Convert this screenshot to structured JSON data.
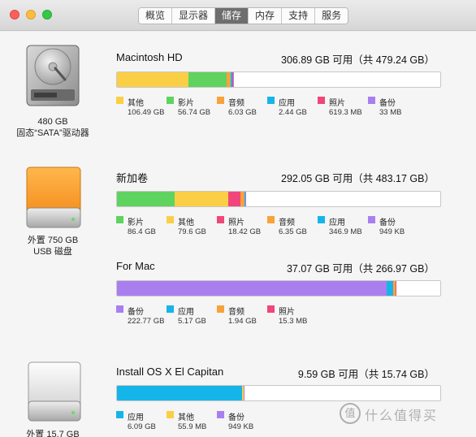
{
  "window": {
    "tabs": [
      {
        "label": "概览",
        "active": false
      },
      {
        "label": "显示器",
        "active": false
      },
      {
        "label": "储存",
        "active": true
      },
      {
        "label": "内存",
        "active": false
      },
      {
        "label": "支持",
        "active": false
      },
      {
        "label": "服务",
        "active": false
      }
    ]
  },
  "colors": {
    "other": "#fbcf45",
    "movies": "#5fd35f",
    "audio": "#f9a23b",
    "apps": "#16b5e9",
    "photos": "#f0467a",
    "backups": "#a97ff0"
  },
  "drives": [
    {
      "icon": "internal-hard-disk-icon",
      "caption_line1": "480 GB",
      "caption_line2": "固态“SATA”驱动器",
      "volumes": [
        {
          "name": "Macintosh HD",
          "summary": "306.89 GB 可用（共 479.24 GB）",
          "segments": [
            {
              "category": "other",
              "fraction": 0.222
            },
            {
              "category": "movies",
              "fraction": 0.118
            },
            {
              "category": "audio",
              "fraction": 0.013
            },
            {
              "category": "apps",
              "fraction": 0.005
            },
            {
              "category": "photos",
              "fraction": 0.002
            },
            {
              "category": "backups",
              "fraction": 0.001
            }
          ],
          "legend": [
            {
              "category": "other",
              "label": "其他",
              "size": "106.49 GB"
            },
            {
              "category": "movies",
              "label": "影片",
              "size": "56.74 GB"
            },
            {
              "category": "audio",
              "label": "音频",
              "size": "6.03 GB"
            },
            {
              "category": "apps",
              "label": "应用",
              "size": "2.44 GB"
            },
            {
              "category": "photos",
              "label": "照片",
              "size": "619.3 MB"
            },
            {
              "category": "backups",
              "label": "备份",
              "size": "33 MB"
            }
          ]
        }
      ]
    },
    {
      "icon": "external-usb-drive-icon",
      "caption_line1": "外置 750 GB",
      "caption_line2": "USB 磁盘",
      "volumes": [
        {
          "name": "新加卷",
          "summary": "292.05 GB 可用（共 483.17 GB）",
          "segments": [
            {
              "category": "movies",
              "fraction": 0.179
            },
            {
              "category": "other",
              "fraction": 0.165
            },
            {
              "category": "photos",
              "fraction": 0.038
            },
            {
              "category": "audio",
              "fraction": 0.013
            },
            {
              "category": "apps",
              "fraction": 0.001
            },
            {
              "category": "backups",
              "fraction": 0.002
            }
          ],
          "legend": [
            {
              "category": "movies",
              "label": "影片",
              "size": "86.4 GB"
            },
            {
              "category": "other",
              "label": "其他",
              "size": "79.6 GB"
            },
            {
              "category": "photos",
              "label": "照片",
              "size": "18.42 GB"
            },
            {
              "category": "audio",
              "label": "音频",
              "size": "6.35 GB"
            },
            {
              "category": "apps",
              "label": "应用",
              "size": "346.9 MB"
            },
            {
              "category": "backups",
              "label": "备份",
              "size": "949 KB"
            }
          ]
        },
        {
          "name": "For Mac",
          "summary": "37.07 GB 可用（共 266.97 GB）",
          "segments": [
            {
              "category": "backups",
              "fraction": 0.834
            },
            {
              "category": "apps",
              "fraction": 0.019
            },
            {
              "category": "audio",
              "fraction": 0.007
            },
            {
              "category": "photos",
              "fraction": 0.001
            }
          ],
          "legend": [
            {
              "category": "backups",
              "label": "备份",
              "size": "222.77 GB"
            },
            {
              "category": "apps",
              "label": "应用",
              "size": "5.17 GB"
            },
            {
              "category": "audio",
              "label": "音频",
              "size": "1.94 GB"
            },
            {
              "category": "photos",
              "label": "照片",
              "size": "15.3 MB"
            }
          ]
        }
      ]
    },
    {
      "icon": "external-drive-icon",
      "caption_line1": "外置 15.7 GB",
      "caption_line2": "",
      "volumes": [
        {
          "name": "Install OS X El Capitan",
          "summary": "9.59 GB 可用（共 15.74 GB）",
          "segments": [
            {
              "category": "apps",
              "fraction": 0.387
            },
            {
              "category": "other",
              "fraction": 0.004
            },
            {
              "category": "backups",
              "fraction": 0.0001
            }
          ],
          "legend": [
            {
              "category": "apps",
              "label": "应用",
              "size": "6.09 GB"
            },
            {
              "category": "other",
              "label": "其他",
              "size": "55.9 MB"
            },
            {
              "category": "backups",
              "label": "备份",
              "size": "949 KB"
            }
          ]
        }
      ]
    }
  ],
  "watermark": {
    "symbol": "值",
    "text": "什么值得买"
  }
}
